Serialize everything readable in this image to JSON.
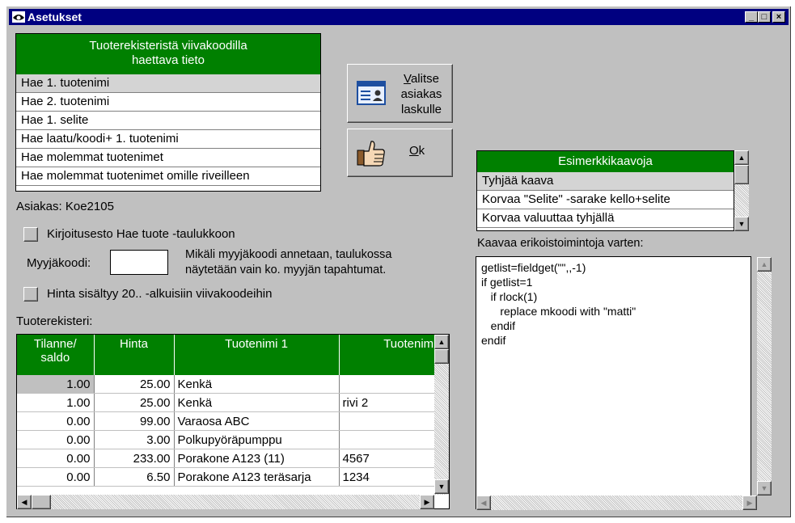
{
  "window": {
    "title": "Asetukset"
  },
  "product_field_list": {
    "header_line1": "Tuoterekisteristä viivakoodilla",
    "header_line2": "haettava tieto",
    "items": [
      "Hae 1. tuotenimi",
      "Hae 2. tuotenimi",
      "Hae 1. selite",
      "Hae laatu/koodi+ 1. tuotenimi",
      "Hae molemmat tuotenimet",
      "Hae molemmat tuotenimet omille riveilleen"
    ],
    "selected_index": 0
  },
  "buttons": {
    "select_customer_mnemonic": "V",
    "select_customer_rest": "alitse",
    "select_customer_line2": "asiakas",
    "select_customer_line3": "laskulle",
    "ok_mnemonic": "O",
    "ok_rest": "k"
  },
  "customer_label": "Asiakas: Koe2105",
  "write_protect_label": "Kirjoitusesto Hae tuote -taulukkoon",
  "seller_code": {
    "label": "Myyjäkoodi:",
    "value": "",
    "hint_line1": "Mikäli myyjäkoodi annetaan, taulukossa",
    "hint_line2": "näytetään vain ko. myyjän tapahtumat."
  },
  "price_in_barcode_label": "Hinta sisältyy 20.. -alkuisiin viivakoodeihin",
  "product_register": {
    "label": "Tuoterekisteri:",
    "columns": [
      "Tilanne/",
      "saldo",
      "Hinta",
      "Tuotenimi 1",
      "Tuotenimi"
    ],
    "rows": [
      [
        "1.00",
        "25.00",
        "Kenkä",
        ""
      ],
      [
        "1.00",
        "25.00",
        "Kenkä",
        "rivi 2"
      ],
      [
        "0.00",
        "99.00",
        "Varaosa ABC",
        ""
      ],
      [
        "0.00",
        "3.00",
        "Polkupyöräpumppu",
        ""
      ],
      [
        "0.00",
        "233.00",
        "Porakone A123 (11)",
        "4567"
      ],
      [
        "0.00",
        "6.50",
        "Porakone A123 teräsarja",
        "1234"
      ]
    ]
  },
  "examples_list": {
    "header": "Esimerkkikaavoja",
    "items": [
      "Tyhjää kaava",
      "Korvaa \"Selite\" -sarake kello+selite",
      "Korvaa valuuttaa tyhjällä"
    ],
    "selected_index": 0
  },
  "formula": {
    "label": "Kaavaa erikoistoimintoja varten:",
    "lines": [
      "getlist=fieldget(\"\",,-1)",
      "if getlist=1",
      "   if rlock(1)",
      "      replace mkoodi with \"matti\"",
      "   endif",
      "endif"
    ]
  }
}
